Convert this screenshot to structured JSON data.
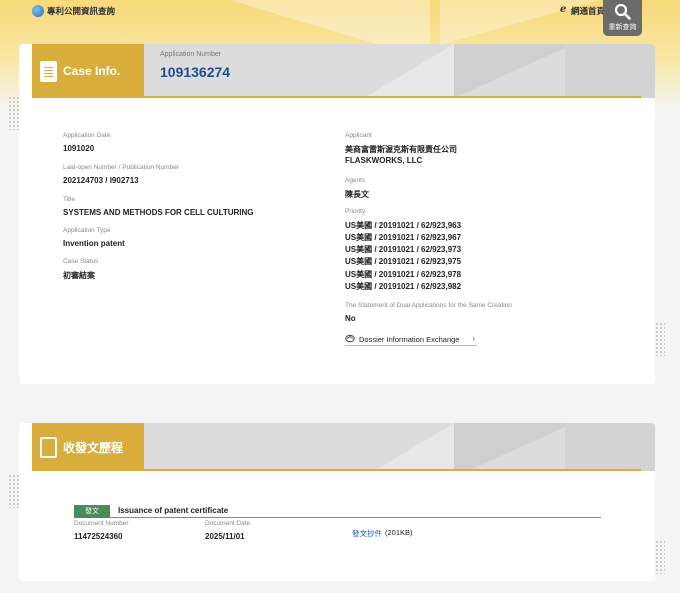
{
  "header": {
    "site_title": "專利公開資訊查詢",
    "home_icon": "e",
    "home_label": "網通首頁",
    "requery_label": "重新查詢",
    "requery_icon": "search-icon"
  },
  "case_info": {
    "title": "Case Info.",
    "application_number_label": "Application Number",
    "application_number": "109136274",
    "left_fields": [
      {
        "label": "Application Date",
        "value": "1091020"
      },
      {
        "label": "Laid-open Number / Publication Number",
        "value": "202124703 / I902713"
      },
      {
        "label": "Title",
        "value": "SYSTEMS AND METHODS FOR CELL CULTURING"
      },
      {
        "label": "Application Type",
        "value": "Invention patent"
      },
      {
        "label": "Case Status",
        "value": "初審結案"
      }
    ],
    "applicant_label": "Applicant",
    "applicant_zh": "美商富雷斯渥克斯有限責任公司",
    "applicant_en": "FLASKWORKS, LLC",
    "agents_label": "Agents",
    "agents_value": "陳長文",
    "priority_label": "Priority",
    "priority": [
      "US美國 / 20191021 / 62/923,963",
      "US美國 / 20191021 / 62/923,967",
      "US美國 / 20191021 / 62/923,973",
      "US美國 / 20191021 / 62/923,975",
      "US美國 / 20191021 / 62/923,978",
      "US美國 / 20191021 / 62/923,982"
    ],
    "dual_label": "The Statement of Dual Applications for the Same Creation",
    "dual_value": "No",
    "dossier_label": "Dossier Information Exchange",
    "dossier_chevron": "›"
  },
  "history": {
    "title": "收發文歷程",
    "tag": "發文",
    "item_title": "Issuance of patent certificate",
    "doc_number_label": "Document Number",
    "doc_number": "11472524360",
    "doc_date_label": "Document Date",
    "doc_date": "2025/11/01",
    "doc_link": "發文抄件",
    "doc_size": "(201KB)"
  }
}
